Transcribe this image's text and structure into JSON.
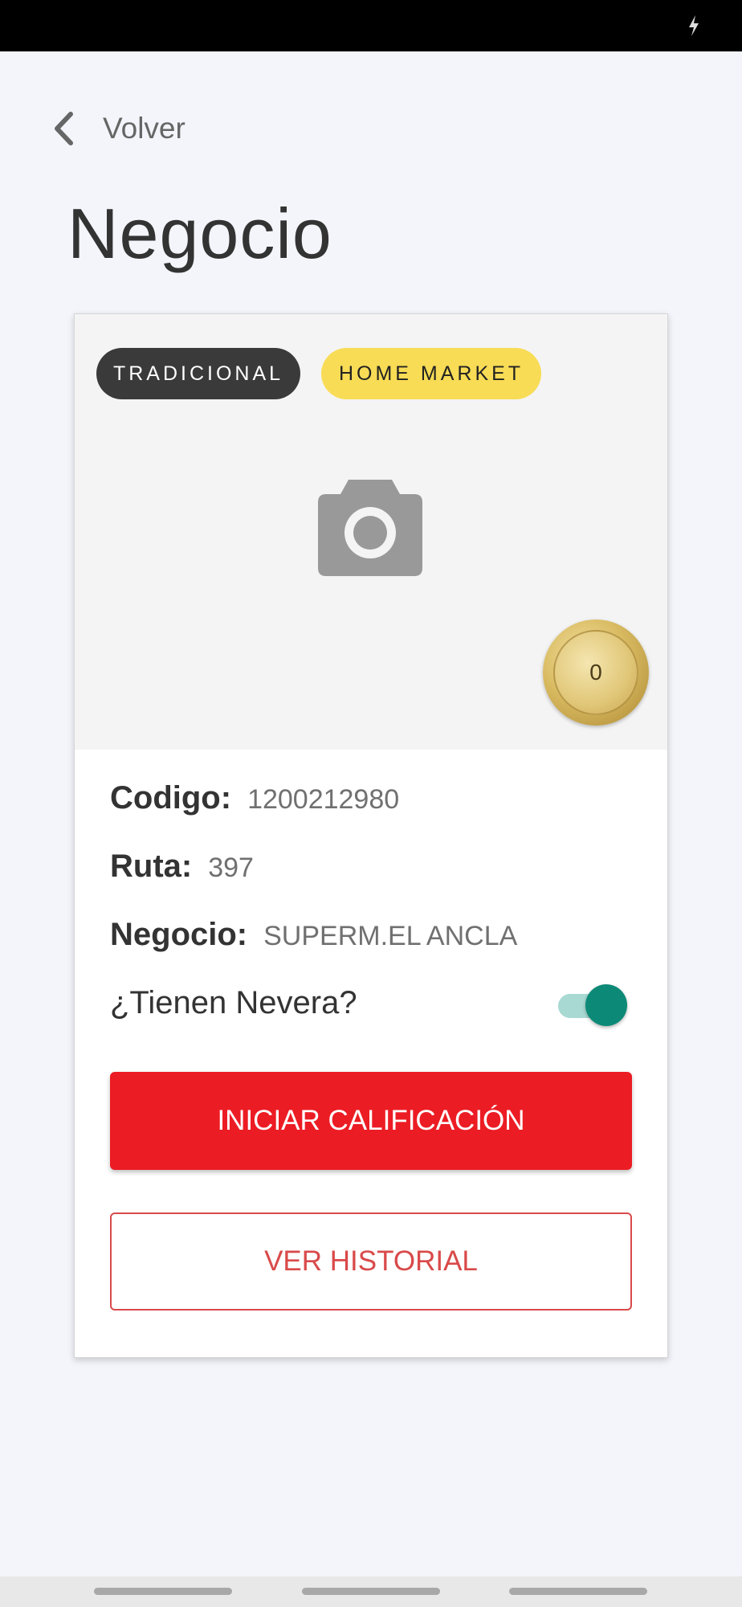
{
  "status_bar": {
    "icon": "charging-bolt-icon"
  },
  "header": {
    "back_label": "Volver",
    "title": "Negocio"
  },
  "card": {
    "tags": [
      "TRADICIONAL",
      "HOME MARKET"
    ],
    "photo_icon": "camera-icon",
    "coin_value": "0",
    "codigo": {
      "label": "Codigo:",
      "value": "1200212980"
    },
    "ruta": {
      "label": "Ruta:",
      "value": "397"
    },
    "negocio": {
      "label": "Negocio:",
      "value": "SUPERM.EL ANCLA"
    },
    "nevera": {
      "label": "¿Tienen Nevera?",
      "checked": true
    },
    "primary_button": "INICIAR CALIFICACIÓN",
    "secondary_button": "VER HISTORIAL"
  },
  "colors": {
    "accent_red": "#ec1c24",
    "toggle_teal": "#0c8a77",
    "tag_yellow": "#f8dc55",
    "tag_dark": "#3a3a3a"
  }
}
